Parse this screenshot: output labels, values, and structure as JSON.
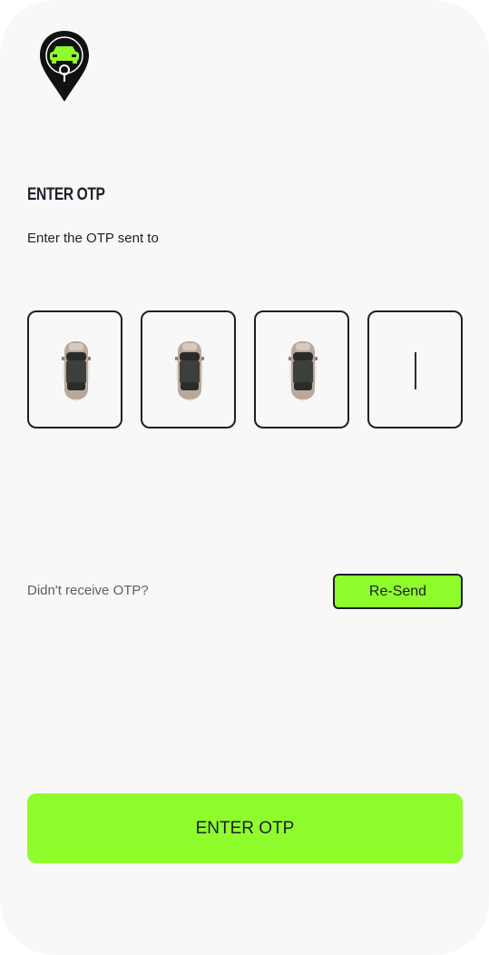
{
  "colors": {
    "background": "#f8f8f8",
    "accent": "#8ffc2c",
    "text_dark": "#1d1f2a",
    "text_muted": "#5b5e66"
  },
  "header": {
    "logo_icon": "car-location-pin-icon"
  },
  "otp": {
    "title": "ENTER OTP",
    "subtitle": "Enter the OTP sent to",
    "boxes": [
      {
        "state": "filled",
        "icon": "car-icon"
      },
      {
        "state": "filled",
        "icon": "car-icon"
      },
      {
        "state": "filled",
        "icon": "car-icon"
      },
      {
        "state": "empty-focused",
        "icon": "text-cursor"
      }
    ]
  },
  "resend": {
    "prompt": "Didn't receive OTP?",
    "button_label": "Re-Send"
  },
  "submit": {
    "label": "ENTER OTP"
  }
}
